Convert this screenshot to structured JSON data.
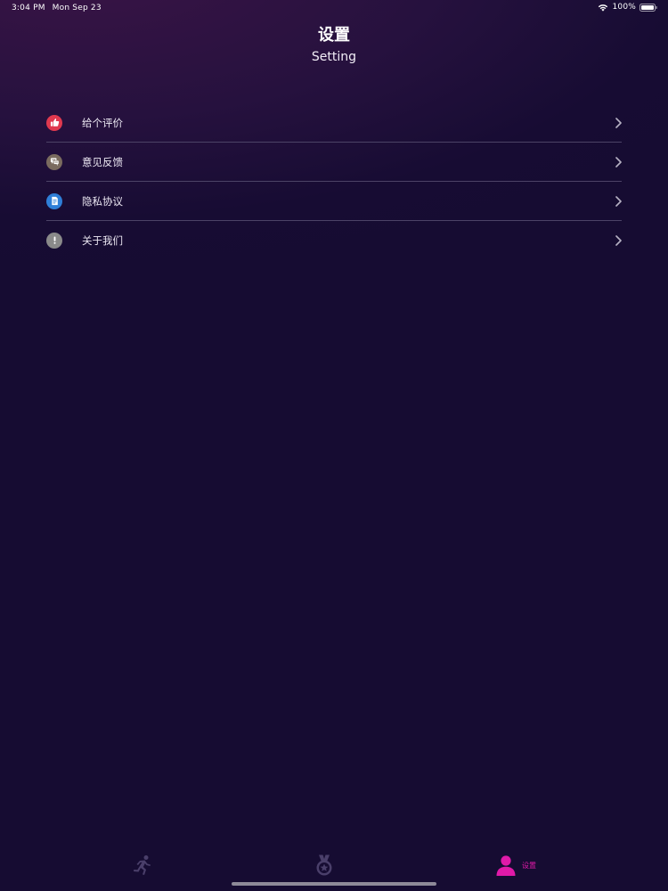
{
  "status_bar": {
    "time": "3:04 PM",
    "date": "Mon Sep 23",
    "battery": "100%"
  },
  "header": {
    "title": "设置",
    "subtitle": "Setting"
  },
  "settings": {
    "items": [
      {
        "label": "给个评价",
        "icon": "thumbs-up-icon",
        "icon_color": "#e0394f"
      },
      {
        "label": "意见反馈",
        "icon": "feedback-chat-icon",
        "icon_color": "#7a6b5f"
      },
      {
        "label": "隐私协议",
        "icon": "document-icon",
        "icon_color": "#2f7fd8"
      },
      {
        "label": "关于我们",
        "icon": "info-exclamation-icon",
        "icon_color": "#8a8a8a"
      }
    ]
  },
  "tabbar": {
    "items": [
      {
        "label": "",
        "icon": "running-icon",
        "active": false
      },
      {
        "label": "",
        "icon": "medal-icon",
        "active": false
      },
      {
        "label": "设置",
        "icon": "person-icon",
        "active": true
      }
    ]
  },
  "colors": {
    "accent": "#e01aa8",
    "inactive_tab": "#4a3f6a",
    "divider": "#4c4366",
    "background": "#160c32"
  }
}
